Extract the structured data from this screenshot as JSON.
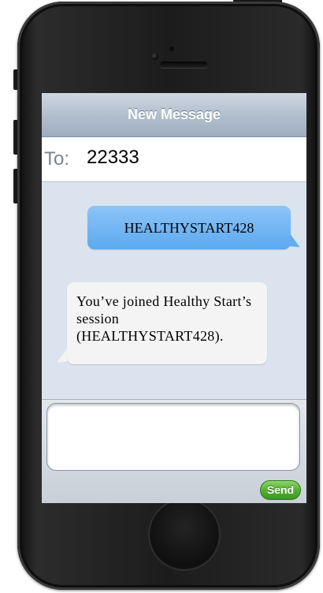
{
  "message_screen": {
    "title": "New Message",
    "to_label": "To:",
    "to_value": "22333"
  },
  "thread": {
    "outgoing": {
      "text": "HEALTHYSTART428"
    },
    "incoming": {
      "text": "You’ve joined Healthy Start’s session (HEALTHYSTART428)."
    }
  },
  "composer": {
    "input_value": "",
    "send_label": "Send"
  },
  "colors": {
    "outgoing_bubble": "#5ba9f0",
    "incoming_bubble": "#f4f4f4",
    "send_button": "#4fae2e",
    "thread_background": "#dbe4ee"
  },
  "icons": [
    "camera-icon",
    "speaker-icon",
    "home-button-icon"
  ]
}
